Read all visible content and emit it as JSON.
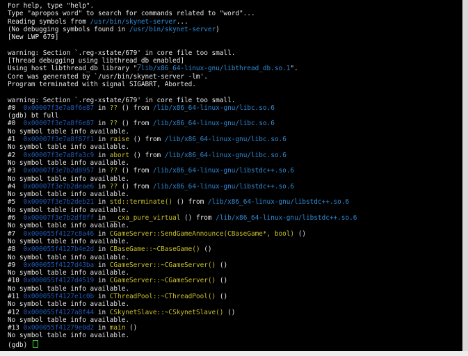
{
  "terminal": {
    "lines": [
      [
        {
          "t": "For help, type \"help\"."
        }
      ],
      [
        {
          "t": "Type \"apropos word\" to search for commands related to \"word\"..."
        }
      ],
      [
        {
          "t": "Reading symbols from "
        },
        {
          "t": "/usr/bin/skynet-server",
          "c": "c"
        },
        {
          "t": "..."
        }
      ],
      [
        {
          "t": "(No debugging symbols found in "
        },
        {
          "t": "/usr/bin/skynet-server",
          "c": "c"
        },
        {
          "t": ")"
        }
      ],
      [
        {
          "t": "[New LWP 679]"
        }
      ],
      [
        {
          "t": ""
        }
      ],
      [
        {
          "t": "warning: Section `.reg-xstate/679' in core file too small."
        }
      ],
      [
        {
          "t": "[Thread debugging using libthread_db enabled]"
        }
      ],
      [
        {
          "t": "Using host libthread_db library \""
        },
        {
          "t": "/lib/x86_64-linux-gnu/libthread_db.so.1",
          "c": "c"
        },
        {
          "t": "\"."
        }
      ],
      [
        {
          "t": "Core was generated by `/usr/bin/skynet-server -lm'."
        }
      ],
      [
        {
          "t": "Program terminated with signal SIGABRT, Aborted."
        }
      ],
      [
        {
          "t": ""
        }
      ],
      [
        {
          "t": "warning: Section `.reg-xstate/679' in core file too small."
        }
      ],
      [
        {
          "t": "#0  "
        },
        {
          "t": "0x00007f3e7a8f6e87",
          "c": "a"
        },
        {
          "t": " in "
        },
        {
          "t": "??",
          "c": "y"
        },
        {
          "t": " () from "
        },
        {
          "t": "/lib/x86_64-linux-gnu/libc.so.6",
          "c": "c"
        }
      ],
      [
        {
          "t": "(gdb) bt full"
        }
      ],
      [
        {
          "t": "#0  "
        },
        {
          "t": "0x00007f3e7a8f6e87",
          "c": "a"
        },
        {
          "t": " in "
        },
        {
          "t": "??",
          "c": "y"
        },
        {
          "t": " () from "
        },
        {
          "t": "/lib/x86_64-linux-gnu/libc.so.6",
          "c": "c"
        }
      ],
      [
        {
          "t": "No symbol table info available."
        }
      ],
      [
        {
          "t": "#1  "
        },
        {
          "t": "0x00007f3e7a8f87f1",
          "c": "a"
        },
        {
          "t": " in "
        },
        {
          "t": "raise",
          "c": "y"
        },
        {
          "t": " () from "
        },
        {
          "t": "/lib/x86_64-linux-gnu/libc.so.6",
          "c": "c"
        }
      ],
      [
        {
          "t": "No symbol table info available."
        }
      ],
      [
        {
          "t": "#2  "
        },
        {
          "t": "0x00007f3e7a8fa3c9",
          "c": "a"
        },
        {
          "t": " in "
        },
        {
          "t": "abort",
          "c": "y"
        },
        {
          "t": " () from "
        },
        {
          "t": "/lib/x86_64-linux-gnu/libc.so.6",
          "c": "c"
        }
      ],
      [
        {
          "t": "No symbol table info available."
        }
      ],
      [
        {
          "t": "#3  "
        },
        {
          "t": "0x00007f3e7b2d8957",
          "c": "a"
        },
        {
          "t": " in "
        },
        {
          "t": "??",
          "c": "y"
        },
        {
          "t": " () from "
        },
        {
          "t": "/lib/x86_64-linux-gnu/libstdc++.so.6",
          "c": "c"
        }
      ],
      [
        {
          "t": "No symbol table info available."
        }
      ],
      [
        {
          "t": "#4  "
        },
        {
          "t": "0x00007f3e7b2deae6",
          "c": "a"
        },
        {
          "t": " in "
        },
        {
          "t": "??",
          "c": "y"
        },
        {
          "t": " () from "
        },
        {
          "t": "/lib/x86_64-linux-gnu/libstdc++.so.6",
          "c": "c"
        }
      ],
      [
        {
          "t": "No symbol table info available."
        }
      ],
      [
        {
          "t": "#5  "
        },
        {
          "t": "0x00007f3e7b2deb21",
          "c": "a"
        },
        {
          "t": " in "
        },
        {
          "t": "std::terminate()",
          "c": "y"
        },
        {
          "t": " () from "
        },
        {
          "t": "/lib/x86_64-linux-gnu/libstdc++.so.6",
          "c": "c"
        }
      ],
      [
        {
          "t": "No symbol table info available."
        }
      ],
      [
        {
          "t": "#6  "
        },
        {
          "t": "0x00007f3e7b2df8ff",
          "c": "a"
        },
        {
          "t": " in "
        },
        {
          "t": "__cxa_pure_virtual",
          "c": "y"
        },
        {
          "t": " () from "
        },
        {
          "t": "/lib/x86_64-linux-gnu/libstdc++.so.6",
          "c": "c"
        }
      ],
      [
        {
          "t": "No symbol table info available."
        }
      ],
      [
        {
          "t": "#7  "
        },
        {
          "t": "0x000055f4127c8a46",
          "c": "a"
        },
        {
          "t": " in "
        },
        {
          "t": "CGameServer::SendGameAnnounce(CBaseGame*, bool)",
          "c": "y"
        },
        {
          "t": " ()"
        }
      ],
      [
        {
          "t": "No symbol table info available."
        }
      ],
      [
        {
          "t": "#8  "
        },
        {
          "t": "0x000055f4127b4e2d",
          "c": "a"
        },
        {
          "t": " in "
        },
        {
          "t": "CBaseGame::~CBaseGame()",
          "c": "y"
        },
        {
          "t": " ()"
        }
      ],
      [
        {
          "t": "No symbol table info available."
        }
      ],
      [
        {
          "t": "#9  "
        },
        {
          "t": "0x000055f4127d43ba",
          "c": "a"
        },
        {
          "t": " in "
        },
        {
          "t": "CGameServer::~CGameServer()",
          "c": "y"
        },
        {
          "t": " ()"
        }
      ],
      [
        {
          "t": "No symbol table info available."
        }
      ],
      [
        {
          "t": "#10 "
        },
        {
          "t": "0x000055f4127d4519",
          "c": "a"
        },
        {
          "t": " in "
        },
        {
          "t": "CGameServer::~CGameServer()",
          "c": "y"
        },
        {
          "t": " ()"
        }
      ],
      [
        {
          "t": "No symbol table info available."
        }
      ],
      [
        {
          "t": "#11 "
        },
        {
          "t": "0x000055f4127e1c0b",
          "c": "a"
        },
        {
          "t": " in "
        },
        {
          "t": "CThreadPool::~CThreadPool()",
          "c": "y"
        },
        {
          "t": " ()"
        }
      ],
      [
        {
          "t": "No symbol table info available."
        }
      ],
      [
        {
          "t": "#12 "
        },
        {
          "t": "0x000055f4127a8f44",
          "c": "a"
        },
        {
          "t": " in "
        },
        {
          "t": "CSkynetSlave::~CSkynetSlave()",
          "c": "y"
        },
        {
          "t": " ()"
        }
      ],
      [
        {
          "t": "No symbol table info available."
        }
      ],
      [
        {
          "t": "#13 "
        },
        {
          "t": "0x000055f41279e0d2",
          "c": "a"
        },
        {
          "t": " in "
        },
        {
          "t": "main",
          "c": "y"
        },
        {
          "t": " ()"
        }
      ],
      [
        {
          "t": "No symbol table info available."
        }
      ],
      [
        {
          "t": "(gdb) "
        }
      ]
    ]
  },
  "colors": {
    "background": "#000000",
    "text": "#e8e8e8",
    "path": "#2f8ad6",
    "function": "#c9c12a",
    "address": "#1f59b8",
    "cursor": "#4ade4a"
  }
}
